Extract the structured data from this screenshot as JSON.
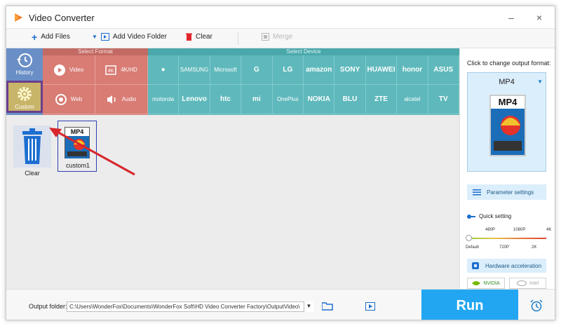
{
  "window": {
    "title": "Video Converter",
    "minimize_icon": "minimize-icon",
    "close_icon": "close-icon"
  },
  "toolbar": {
    "add_files": "Add Files",
    "add_video_folder": "Add Video Folder",
    "clear": "Clear",
    "merge": "Merge"
  },
  "sidebar": {
    "history": "History",
    "custom": "Custom"
  },
  "format_panel": {
    "header": "Select Format",
    "items": [
      "Video",
      "4K/HD",
      "Web",
      "Audio"
    ]
  },
  "device_panel": {
    "header": "Select Device",
    "brands": [
      "apple",
      "SAMSUNG",
      "Microsoft",
      "G",
      "LG",
      "amazon",
      "SONY",
      "HUAWEI",
      "honor",
      "ASUS",
      "motorola",
      "Lenovo",
      "htc",
      "mi",
      "OnePlus",
      "NOKIA",
      "BLU",
      "ZTE",
      "alcatel",
      "TV"
    ]
  },
  "files": [
    {
      "label": "Clear"
    },
    {
      "label": "custom1",
      "badge": "MP4"
    }
  ],
  "right_panel": {
    "title": "Click to change output format:",
    "format": "MP4",
    "parameter_settings": "Parameter settings",
    "quick_setting": "Quick setting",
    "quality_top": [
      "480P",
      "1080P",
      "4K"
    ],
    "quality_bottom": [
      "Default",
      "720P",
      "2K"
    ],
    "quality_value": 0.0,
    "hardware_acceleration": "Hardware acceleration",
    "gpu": [
      "NVIDIA",
      "Intel"
    ]
  },
  "bottom": {
    "output_label": "Output folder:",
    "output_path": "C:\\Users\\WonderFox\\Documents\\WonderFox Soft\\HD Video Converter Factory\\OutputVideo\\",
    "run": "Run"
  },
  "colors": {
    "accent_blue": "#22a6f2",
    "format_red": "#d87c74",
    "device_teal": "#5fb9bc",
    "sidebar_blue": "#6a8fc7",
    "custom_gold": "#c8b56a",
    "annotation_red": "#d8262c"
  }
}
